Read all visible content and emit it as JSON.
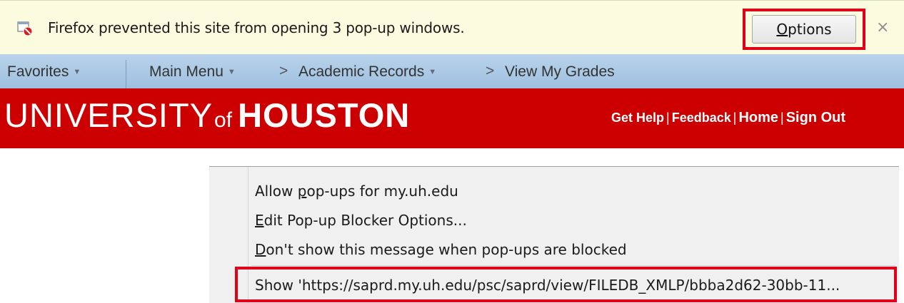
{
  "notification": {
    "message": "Firefox prevented this site from opening 3 pop-up windows.",
    "options_label_underlined": "O",
    "options_label_rest": "ptions",
    "close_label": "×"
  },
  "breadcrumb": {
    "favorites": "Favorites",
    "main_menu": "Main Menu",
    "separator": ">",
    "academic_records": "Academic Records",
    "view_my_grades": "View My Grades"
  },
  "banner": {
    "logo_university": "UNIVERSITY",
    "logo_of": "of",
    "logo_houston": "HOUSTON",
    "links": {
      "get_help": "Get Help",
      "feedback": "Feedback",
      "home": "Home",
      "sign_out": "Sign Out"
    }
  },
  "context_menu": {
    "allow_prefix": "Allow ",
    "allow_key": "p",
    "allow_rest": "op-ups for my.uh.edu",
    "edit_key": "E",
    "edit_rest": "dit Pop-up Blocker Options...",
    "dont_key": "D",
    "dont_rest": "on't show this message when pop-ups are blocked",
    "show_item": "Show 'https://saprd.my.uh.edu/psc/saprd/view/FILEDB_XMLP/bbba2d62-30bb-11..."
  },
  "colors": {
    "banner_red": "#cc0000",
    "highlight_red": "#e0001a",
    "notification_bg": "#fbfbe0"
  }
}
